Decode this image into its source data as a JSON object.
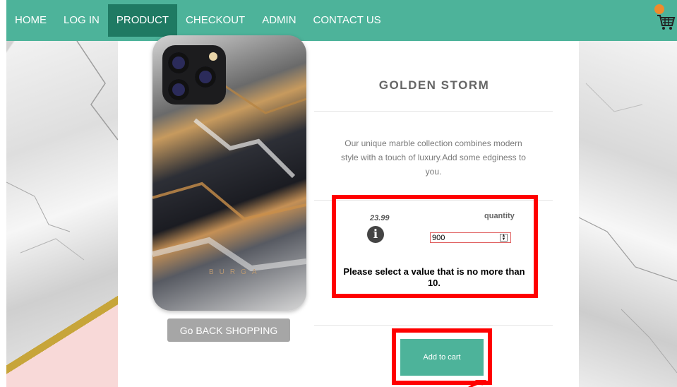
{
  "nav": {
    "items": [
      {
        "label": "HOME"
      },
      {
        "label": "LOG IN"
      },
      {
        "label": "PRODUCT"
      },
      {
        "label": "CHECKOUT"
      },
      {
        "label": "ADMIN"
      },
      {
        "label": "CONTACT US"
      }
    ],
    "active_index": 2
  },
  "cart": {
    "icon": "shopping-cart-icon",
    "badge_color": "#ef8b2c"
  },
  "product": {
    "title": "GOLDEN STORM",
    "description": "Our unique marble collection combines modern style with a touch of luxury.Add some edginess to you.",
    "price": "23.99",
    "quantity_label": "quantity",
    "quantity_value": "900",
    "validation_message": "Please select a value that is no more than 10.",
    "phone_brand_text": "BURGA"
  },
  "buttons": {
    "back_shopping": "Go BACK SHOPPING",
    "add_to_cart": "Add to cart"
  },
  "colors": {
    "accent": "#4db39a",
    "nav_active": "#1f7a63",
    "highlight": "#ff0000"
  }
}
